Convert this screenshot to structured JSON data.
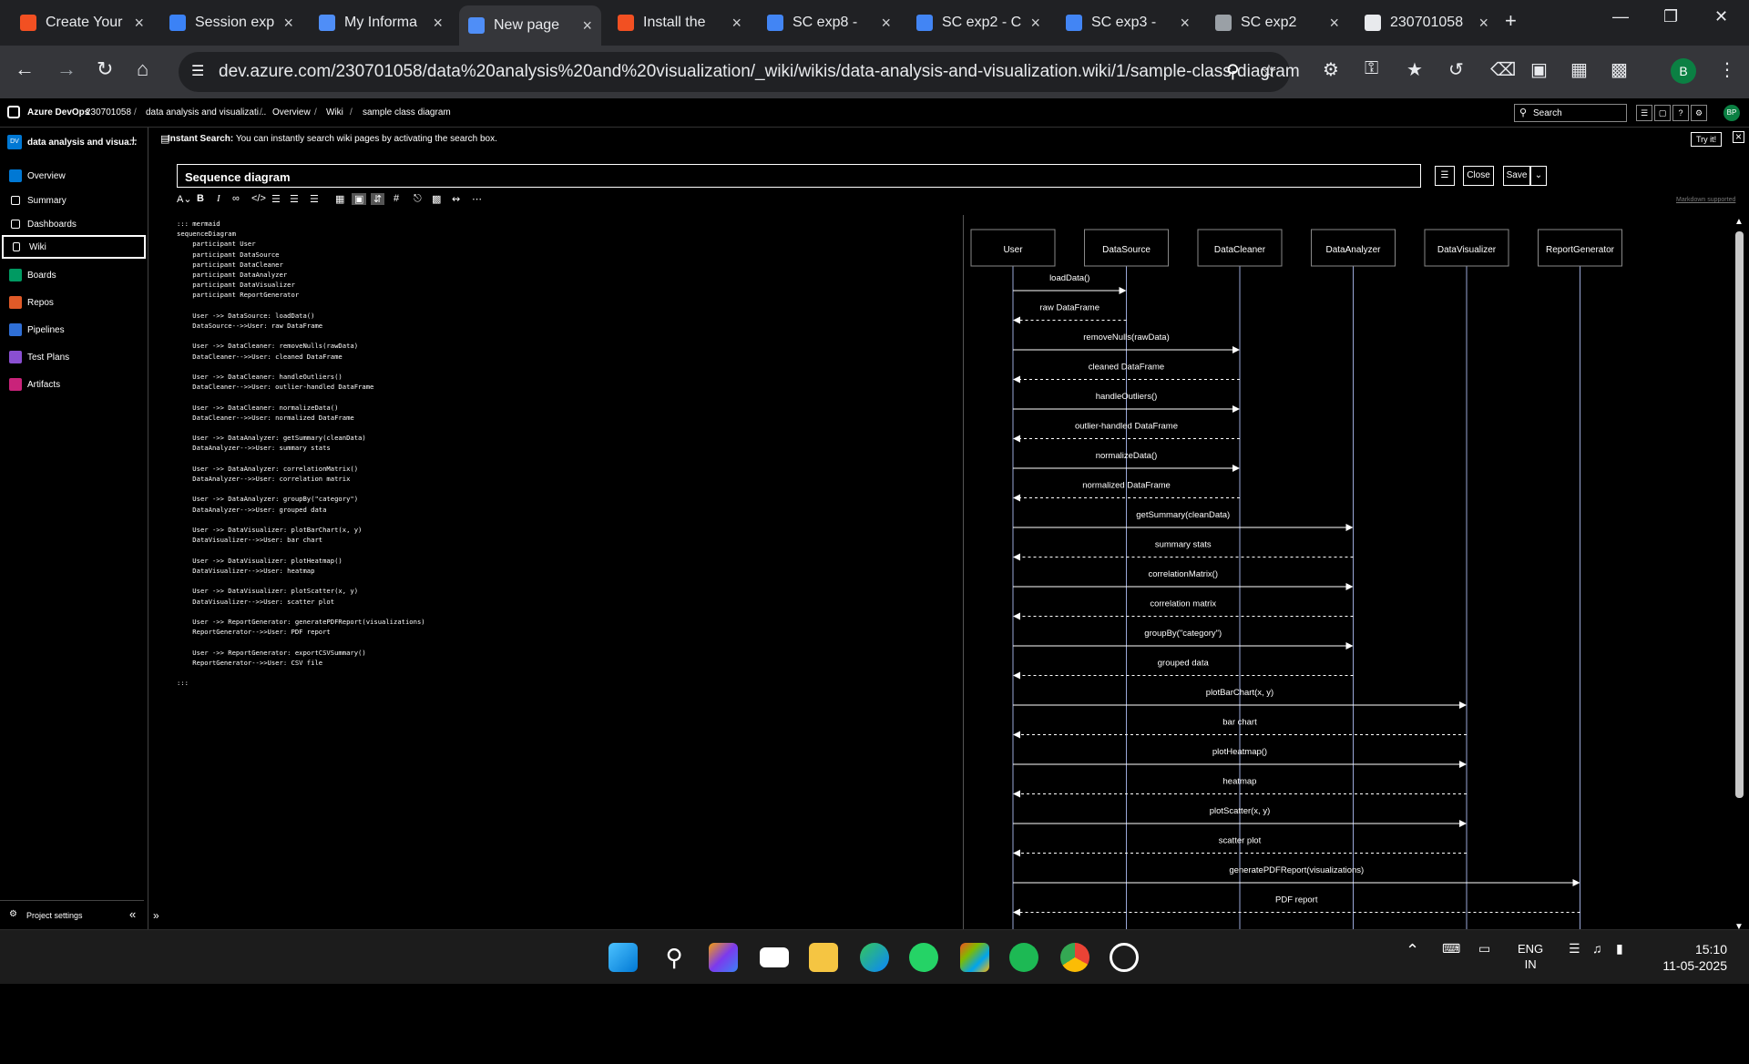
{
  "browser": {
    "tabs": [
      {
        "title": "Create Your",
        "color": "#f25022"
      },
      {
        "title": "Session exp",
        "color": "#3b82f6"
      },
      {
        "title": "My Informa",
        "color": "#4f8ef7"
      },
      {
        "title": "New page",
        "color": "#4f8ef7"
      },
      {
        "title": "Install the",
        "color": "#f25022"
      },
      {
        "title": "SC exp8 -",
        "color": "#4285f4"
      },
      {
        "title": "SC exp2 - C",
        "color": "#4285f4"
      },
      {
        "title": "SC exp3 -",
        "color": "#4285f4"
      },
      {
        "title": "SC exp2",
        "color": "#9aa0a6"
      },
      {
        "title": "230701058",
        "color": "#e8eaed"
      }
    ],
    "url": "dev.azure.com/230701058/data%20analysis%20and%20visualization/_wiki/wikis/data-analysis-and-visualization.wiki/1/sample-class-diagram",
    "profile_initial": "B"
  },
  "ado": {
    "brand": "Azure DevOps",
    "org": "230701058",
    "breadcrumbs": [
      "data analysis and visualizati...",
      "Overview",
      "Wiki",
      "sample class diagram"
    ],
    "search_placeholder": "Search",
    "user_initials": "BP",
    "project_name": "data analysis and visua...",
    "project_initials": "DV",
    "sidebar": [
      "Overview",
      "Summary",
      "Dashboards",
      "Wiki",
      "Boards",
      "Repos",
      "Pipelines",
      "Test Plans",
      "Artifacts"
    ],
    "project_settings": "Project settings",
    "banner_bold": "Instant Search:",
    "banner_text": "You can instantly search wiki pages by activating the search box.",
    "try_it": "Try it!",
    "page_title": "Sequence diagram",
    "close": "Close",
    "save": "Save",
    "markdown_supported": "Markdown supported"
  },
  "editor_lines": [
    "::: mermaid",
    "sequenceDiagram",
    "    participant User",
    "    participant DataSource",
    "    participant DataCleaner",
    "    participant DataAnalyzer",
    "    participant DataVisualizer",
    "    participant ReportGenerator",
    "",
    "    User ->> DataSource: loadData()",
    "    DataSource-->>User: raw DataFrame",
    "",
    "    User ->> DataCleaner: removeNulls(rawData)",
    "    DataCleaner-->>User: cleaned DataFrame",
    "",
    "    User ->> DataCleaner: handleOutliers()",
    "    DataCleaner-->>User: outlier-handled DataFrame",
    "",
    "    User ->> DataCleaner: normalizeData()",
    "    DataCleaner-->>User: normalized DataFrame",
    "",
    "    User ->> DataAnalyzer: getSummary(cleanData)",
    "    DataAnalyzer-->>User: summary stats",
    "",
    "    User ->> DataAnalyzer: correlationMatrix()",
    "    DataAnalyzer-->>User: correlation matrix",
    "",
    "    User ->> DataAnalyzer: groupBy(\"category\")",
    "    DataAnalyzer-->>User: grouped data",
    "",
    "    User ->> DataVisualizer: plotBarChart(x, y)",
    "    DataVisualizer-->>User: bar chart",
    "",
    "    User ->> DataVisualizer: plotHeatmap()",
    "    DataVisualizer-->>User: heatmap",
    "",
    "    User ->> DataVisualizer: plotScatter(x, y)",
    "    DataVisualizer-->>User: scatter plot",
    "",
    "    User ->> ReportGenerator: generatePDFReport(visualizations)",
    "    ReportGenerator-->>User: PDF report",
    "",
    "    User ->> ReportGenerator: exportCSVSummary()",
    "    ReportGenerator-->>User: CSV file",
    "",
    ":::"
  ],
  "diagram": {
    "participants": [
      "User",
      "DataSource",
      "DataCleaner",
      "DataAnalyzer",
      "DataVisualizer",
      "ReportGenerator"
    ],
    "messages": [
      {
        "from": 0,
        "to": 1,
        "label": "loadData()",
        "dashed": false
      },
      {
        "from": 1,
        "to": 0,
        "label": "raw DataFrame",
        "dashed": true
      },
      {
        "from": 0,
        "to": 2,
        "label": "removeNulls(rawData)",
        "dashed": false
      },
      {
        "from": 2,
        "to": 0,
        "label": "cleaned DataFrame",
        "dashed": true
      },
      {
        "from": 0,
        "to": 2,
        "label": "handleOutliers()",
        "dashed": false
      },
      {
        "from": 2,
        "to": 0,
        "label": "outlier-handled DataFrame",
        "dashed": true
      },
      {
        "from": 0,
        "to": 2,
        "label": "normalizeData()",
        "dashed": false
      },
      {
        "from": 2,
        "to": 0,
        "label": "normalized DataFrame",
        "dashed": true
      },
      {
        "from": 0,
        "to": 3,
        "label": "getSummary(cleanData)",
        "dashed": false
      },
      {
        "from": 3,
        "to": 0,
        "label": "summary stats",
        "dashed": true
      },
      {
        "from": 0,
        "to": 3,
        "label": "correlationMatrix()",
        "dashed": false
      },
      {
        "from": 3,
        "to": 0,
        "label": "correlation matrix",
        "dashed": true
      },
      {
        "from": 0,
        "to": 3,
        "label": "groupBy(\"category\")",
        "dashed": false
      },
      {
        "from": 3,
        "to": 0,
        "label": "grouped data",
        "dashed": true
      },
      {
        "from": 0,
        "to": 4,
        "label": "plotBarChart(x, y)",
        "dashed": false
      },
      {
        "from": 4,
        "to": 0,
        "label": "bar chart",
        "dashed": true
      },
      {
        "from": 0,
        "to": 4,
        "label": "plotHeatmap()",
        "dashed": false
      },
      {
        "from": 4,
        "to": 0,
        "label": "heatmap",
        "dashed": true
      },
      {
        "from": 0,
        "to": 4,
        "label": "plotScatter(x, y)",
        "dashed": false
      },
      {
        "from": 4,
        "to": 0,
        "label": "scatter plot",
        "dashed": true
      },
      {
        "from": 0,
        "to": 5,
        "label": "generatePDFReport(visualizations)",
        "dashed": false
      },
      {
        "from": 5,
        "to": 0,
        "label": "PDF report",
        "dashed": true
      }
    ]
  },
  "taskbar": {
    "lang1": "ENG",
    "lang2": "IN",
    "time": "15:10",
    "date": "11-05-2025"
  },
  "colors": {
    "lifeline": "#9aa8d8",
    "accent": "#0078d4"
  }
}
